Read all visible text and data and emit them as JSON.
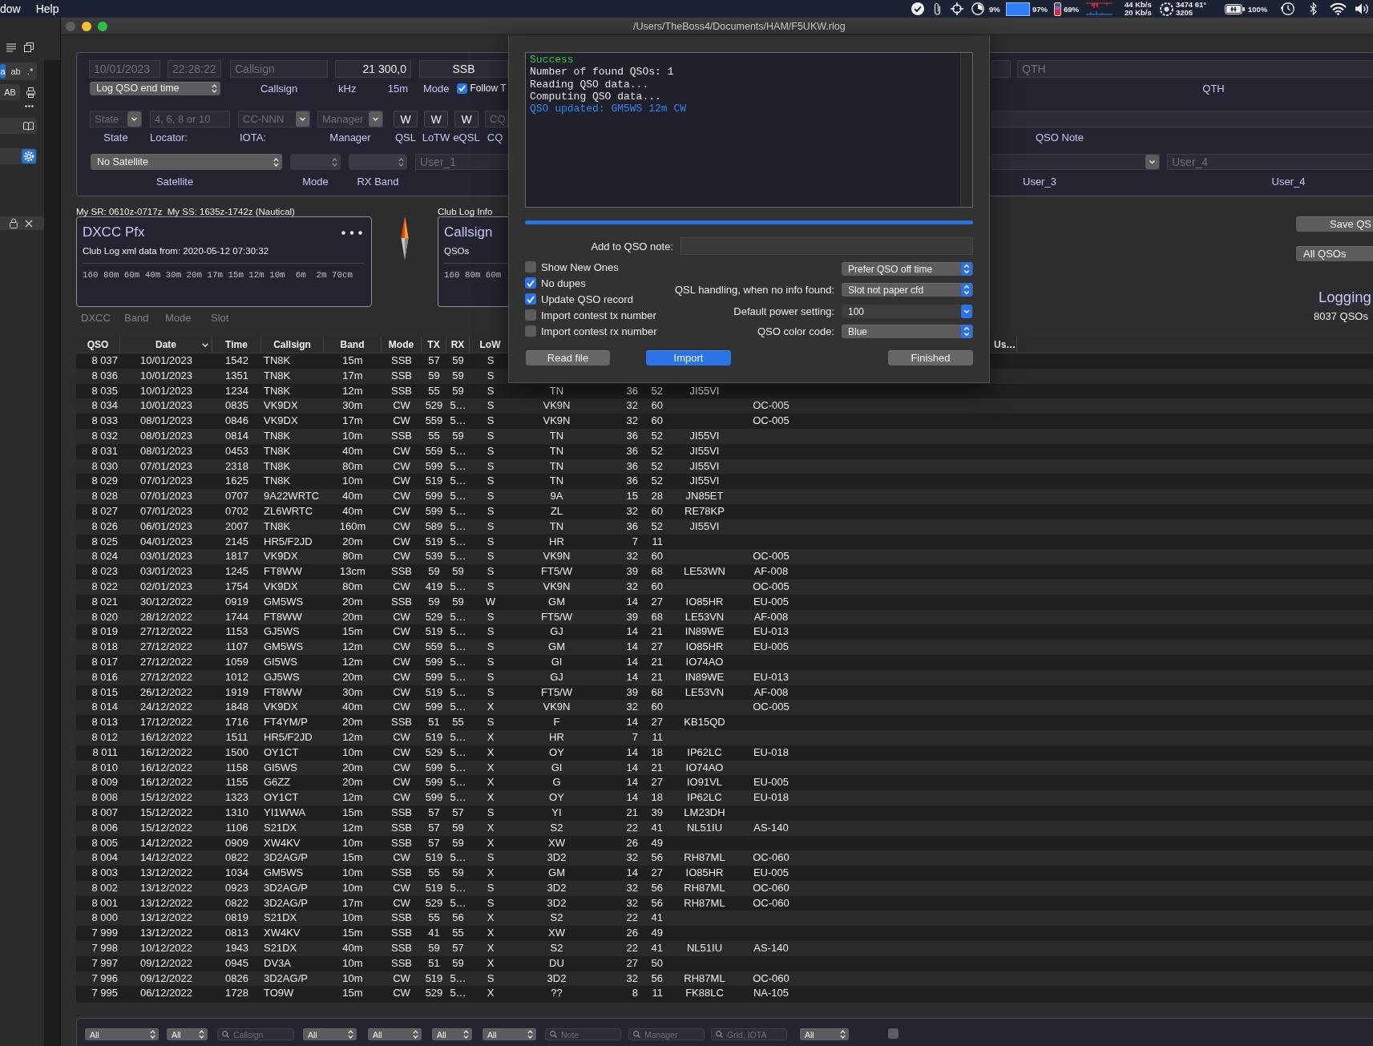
{
  "menu_bar": {
    "menus": [
      "dow",
      "Help"
    ],
    "status_texts": [
      "9%",
      "97%",
      "69%",
      "44 Kb/s",
      "20 Kb/s",
      "3474 61°",
      "3205",
      "100%"
    ]
  },
  "side_panel": {
    "tools": [
      {
        "kind": "lines",
        "selected": false
      },
      {
        "kind": "windows",
        "selected": false
      },
      {
        "kind": "glyph",
        "text": "a",
        "selected": true
      },
      {
        "kind": "glyph",
        "text": "ab",
        "selected": false
      },
      {
        "kind": "glyph",
        "text": ".*",
        "selected": false
      },
      {
        "kind": "glyph",
        "text": "AB",
        "selected": false
      },
      {
        "kind": "printer",
        "selected": false
      },
      {
        "kind": "dots",
        "selected": false
      },
      {
        "kind": "book",
        "selected": false
      },
      {
        "kind": "gear",
        "selected": true
      },
      {
        "kind": "lock",
        "selected": false
      },
      {
        "kind": "close",
        "selected": false
      }
    ]
  },
  "window": {
    "title": "/Users/TheBoss4/Documents/HAM/F5UKW.rlog"
  },
  "entry_form": {
    "date_field": {
      "placeholder": "10/01/2023"
    },
    "time_field": {
      "placeholder": "22:28:22"
    },
    "callsign_field": {
      "placeholder": "Callsign"
    },
    "frequency_field": {
      "value": "21 300,0"
    },
    "mode_field": {
      "value": "SSB"
    },
    "time_option_popup": "Log QSO end time",
    "callsign_label": "Callsign",
    "frequency_unit": "kHz",
    "band": "15m",
    "mode_label": "Mode",
    "follow_checkbox": {
      "label": "Follow T",
      "checked": true
    },
    "qth_field": {
      "placeholder": "QTH"
    },
    "qth_label": "QTH",
    "state_popup": {
      "placeholder": "State"
    },
    "state_label": "State",
    "locator_field": {
      "placeholder": "4, 6, 8 or 10"
    },
    "locator_label": "Locator:",
    "iota_combo": {
      "placeholder": "CC-NNN"
    },
    "iota_label": "IOTA:",
    "manager_combo": {
      "placeholder": "Manager"
    },
    "manager_label": "Manager",
    "qsl_buttons": [
      {
        "text": "W",
        "label": "QSL"
      },
      {
        "text": "W",
        "label": "LoTW"
      },
      {
        "text": "W",
        "label": "eQSL"
      }
    ],
    "cq_field": {
      "placeholder": "CQ"
    },
    "cq_label": "CQ",
    "qso_note_label": "QSO Note",
    "satellite_popup": "No Satellite",
    "satellite_label": "Satellite",
    "sat_mode_label": "Mode",
    "rx_band_label": "RX Band",
    "user_1_field": {
      "placeholder": "User_1"
    },
    "user_3_label": "User_3",
    "user_4_field": {
      "placeholder": "User_4"
    },
    "user_4_label": "User_4"
  },
  "info": {
    "sun_times": "My SR: 0610z-0717z  My SS: 1635z-1742z (Nautical)",
    "dxcc_panel": {
      "title": "DXCC Pfx",
      "source": "Club Log xml data from: 2020-05-12 07:30:32",
      "bands": "160 80m 60m 40m 30m 20m 17m 15m 12m 10m  6m  2m 70cm"
    },
    "view_tabs": [
      "DXCC",
      "Band",
      "Mode",
      "Slot"
    ],
    "club_log_label": "Club Log Info",
    "club_log_panel": {
      "title": "Callsign",
      "subtitle": "QSOs",
      "bands": "160 80m 60m"
    }
  },
  "side_actions": {
    "save_button": "Save QS",
    "qso_filter": "All QSOs",
    "title": "Logging",
    "qso_count": "8037 QSOs"
  },
  "table": {
    "columns": [
      {
        "label": "QSO",
        "sorted": false
      },
      {
        "label": "Date",
        "sorted": true
      },
      {
        "label": "Time",
        "sorted": false
      },
      {
        "label": "Callsign",
        "sorted": false
      },
      {
        "label": "Band",
        "sorted": false
      },
      {
        "label": "Mode",
        "sorted": false
      },
      {
        "label": "TX",
        "sorted": false
      },
      {
        "label": "RX",
        "sorted": false
      },
      {
        "label": "LoW",
        "sorted": false
      },
      {
        "label": "Us…",
        "sorted": false
      }
    ],
    "rows": [
      {
        "qso": "8 037",
        "date": "10/01/2023",
        "time": "1542",
        "callsign": "TN8K",
        "band": "15m",
        "mode": "SSB",
        "tx": "57",
        "rx": "59",
        "low": "S"
      },
      {
        "qso": "8 036",
        "date": "10/01/2023",
        "time": "1351",
        "callsign": "TN8K",
        "band": "17m",
        "mode": "SSB",
        "tx": "59",
        "rx": "59",
        "low": "S"
      },
      {
        "qso": "8 035",
        "date": "10/01/2023",
        "time": "1234",
        "callsign": "TN8K",
        "band": "12m",
        "mode": "SSB",
        "tx": "55",
        "rx": "59",
        "low": "S",
        "column_10": "TN",
        "column_11": "36",
        "column_12": "52",
        "column_13": "JI55VI"
      },
      {
        "qso": "8 034",
        "date": "10/01/2023",
        "time": "0835",
        "callsign": "VK9DX",
        "band": "30m",
        "mode": "CW",
        "tx": "529",
        "rx": "5…",
        "low": "S",
        "column_10": "VK9N",
        "column_11": "32",
        "column_12": "60",
        "column_14": "OC-005"
      },
      {
        "qso": "8 033",
        "date": "08/01/2023",
        "time": "0846",
        "callsign": "VK9DX",
        "band": "17m",
        "mode": "CW",
        "tx": "559",
        "rx": "5…",
        "low": "S",
        "column_10": "VK9N",
        "column_11": "32",
        "column_12": "60",
        "column_14": "OC-005"
      },
      {
        "qso": "8 032",
        "date": "08/01/2023",
        "time": "0814",
        "callsign": "TN8K",
        "band": "10m",
        "mode": "SSB",
        "tx": "55",
        "rx": "59",
        "low": "S",
        "column_10": "TN",
        "column_11": "36",
        "column_12": "52",
        "column_13": "JI55VI"
      },
      {
        "qso": "8 031",
        "date": "08/01/2023",
        "time": "0453",
        "callsign": "TN8K",
        "band": "40m",
        "mode": "CW",
        "tx": "559",
        "rx": "5…",
        "low": "S",
        "column_10": "TN",
        "column_11": "36",
        "column_12": "52",
        "column_13": "JI55VI"
      },
      {
        "qso": "8 030",
        "date": "07/01/2023",
        "time": "2318",
        "callsign": "TN8K",
        "band": "80m",
        "mode": "CW",
        "tx": "599",
        "rx": "5…",
        "low": "S",
        "column_10": "TN",
        "column_11": "36",
        "column_12": "52",
        "column_13": "JI55VI"
      },
      {
        "qso": "8 029",
        "date": "07/01/2023",
        "time": "1625",
        "callsign": "TN8K",
        "band": "10m",
        "mode": "CW",
        "tx": "519",
        "rx": "5…",
        "low": "S",
        "column_10": "TN",
        "column_11": "36",
        "column_12": "52",
        "column_13": "JI55VI"
      },
      {
        "qso": "8 028",
        "date": "07/01/2023",
        "time": "0707",
        "callsign": "9A22WRTC",
        "band": "40m",
        "mode": "CW",
        "tx": "599",
        "rx": "5…",
        "low": "S",
        "column_10": "9A",
        "column_11": "15",
        "column_12": "28",
        "column_13": "JN85ET"
      },
      {
        "qso": "8 027",
        "date": "07/01/2023",
        "time": "0702",
        "callsign": "ZL6WRTC",
        "band": "40m",
        "mode": "CW",
        "tx": "599",
        "rx": "5…",
        "low": "S",
        "column_10": "ZL",
        "column_11": "32",
        "column_12": "60",
        "column_13": "RE78KP"
      },
      {
        "qso": "8 026",
        "date": "06/01/2023",
        "time": "2007",
        "callsign": "TN8K",
        "band": "160m",
        "mode": "CW",
        "tx": "589",
        "rx": "5…",
        "low": "S",
        "column_10": "TN",
        "column_11": "36",
        "column_12": "52",
        "column_13": "JI55VI"
      },
      {
        "qso": "8 025",
        "date": "04/01/2023",
        "time": "2145",
        "callsign": "HR5/F2JD",
        "band": "20m",
        "mode": "CW",
        "tx": "519",
        "rx": "5…",
        "low": "S",
        "column_10": "HR",
        "column_11": "7",
        "column_12": "11"
      },
      {
        "qso": "8 024",
        "date": "03/01/2023",
        "time": "1817",
        "callsign": "VK9DX",
        "band": "80m",
        "mode": "CW",
        "tx": "539",
        "rx": "5…",
        "low": "S",
        "column_10": "VK9N",
        "column_11": "32",
        "column_12": "60",
        "column_14": "OC-005"
      },
      {
        "qso": "8 023",
        "date": "03/01/2023",
        "time": "1245",
        "callsign": "FT8WW",
        "band": "13cm",
        "mode": "SSB",
        "tx": "59",
        "rx": "59",
        "low": "S",
        "column_10": "FT5/W",
        "column_11": "39",
        "column_12": "68",
        "column_13": "LE53WN",
        "column_14": "AF-008"
      },
      {
        "qso": "8 022",
        "date": "02/01/2023",
        "time": "1754",
        "callsign": "VK9DX",
        "band": "80m",
        "mode": "CW",
        "tx": "419",
        "rx": "5…",
        "low": "S",
        "column_10": "VK9N",
        "column_11": "32",
        "column_12": "60",
        "column_14": "OC-005"
      },
      {
        "qso": "8 021",
        "date": "30/12/2022",
        "time": "0919",
        "callsign": "GM5WS",
        "band": "20m",
        "mode": "SSB",
        "tx": "59",
        "rx": "59",
        "low": "W",
        "column_10": "GM",
        "column_11": "14",
        "column_12": "27",
        "column_13": "IO85HR",
        "column_14": "EU-005"
      },
      {
        "qso": "8 020",
        "date": "28/12/2022",
        "time": "1744",
        "callsign": "FT8WW",
        "band": "20m",
        "mode": "CW",
        "tx": "529",
        "rx": "5…",
        "low": "S",
        "column_10": "FT5/W",
        "column_11": "39",
        "column_12": "68",
        "column_13": "LE53VN",
        "column_14": "AF-008"
      },
      {
        "qso": "8 019",
        "date": "27/12/2022",
        "time": "1153",
        "callsign": "GJ5WS",
        "band": "15m",
        "mode": "CW",
        "tx": "519",
        "rx": "5…",
        "low": "S",
        "column_10": "GJ",
        "column_11": "14",
        "column_12": "21",
        "column_13": "IN89WE",
        "column_14": "EU-013"
      },
      {
        "qso": "8 018",
        "date": "27/12/2022",
        "time": "1107",
        "callsign": "GM5WS",
        "band": "12m",
        "mode": "CW",
        "tx": "559",
        "rx": "5…",
        "low": "S",
        "column_10": "GM",
        "column_11": "14",
        "column_12": "27",
        "column_13": "IO85HR",
        "column_14": "EU-005"
      },
      {
        "qso": "8 017",
        "date": "27/12/2022",
        "time": "1059",
        "callsign": "GI5WS",
        "band": "12m",
        "mode": "CW",
        "tx": "599",
        "rx": "5…",
        "low": "S",
        "column_10": "GI",
        "column_11": "14",
        "column_12": "21",
        "column_13": "IO74AO"
      },
      {
        "qso": "8 016",
        "date": "27/12/2022",
        "time": "1012",
        "callsign": "GJ5WS",
        "band": "20m",
        "mode": "CW",
        "tx": "599",
        "rx": "5…",
        "low": "S",
        "column_10": "GJ",
        "column_11": "14",
        "column_12": "21",
        "column_13": "IN89WE",
        "column_14": "EU-013"
      },
      {
        "qso": "8 015",
        "date": "26/12/2022",
        "time": "1919",
        "callsign": "FT8WW",
        "band": "30m",
        "mode": "CW",
        "tx": "519",
        "rx": "5…",
        "low": "S",
        "column_10": "FT5/W",
        "column_11": "39",
        "column_12": "68",
        "column_13": "LE53VN",
        "column_14": "AF-008"
      },
      {
        "qso": "8 014",
        "date": "24/12/2022",
        "time": "1848",
        "callsign": "VK9DX",
        "band": "40m",
        "mode": "CW",
        "tx": "599",
        "rx": "5…",
        "low": "X",
        "column_10": "VK9N",
        "column_11": "32",
        "column_12": "60",
        "column_14": "OC-005"
      },
      {
        "qso": "8 013",
        "date": "17/12/2022",
        "time": "1716",
        "callsign": "FT4YM/P",
        "band": "20m",
        "mode": "SSB",
        "tx": "51",
        "rx": "55",
        "low": "S",
        "column_10": "F",
        "column_11": "14",
        "column_12": "27",
        "column_13": "KB15QD"
      },
      {
        "qso": "8 012",
        "date": "16/12/2022",
        "time": "1511",
        "callsign": "HR5/F2JD",
        "band": "12m",
        "mode": "CW",
        "tx": "519",
        "rx": "5…",
        "low": "X",
        "column_10": "HR",
        "column_11": "7",
        "column_12": "11"
      },
      {
        "qso": "8 011",
        "date": "16/12/2022",
        "time": "1500",
        "callsign": "OY1CT",
        "band": "10m",
        "mode": "CW",
        "tx": "529",
        "rx": "5…",
        "low": "X",
        "column_10": "OY",
        "column_11": "14",
        "column_12": "18",
        "column_13": "IP62LC",
        "column_14": "EU-018"
      },
      {
        "qso": "8 010",
        "date": "16/12/2022",
        "time": "1158",
        "callsign": "GI5WS",
        "band": "20m",
        "mode": "CW",
        "tx": "599",
        "rx": "5…",
        "low": "X",
        "column_10": "GI",
        "column_11": "14",
        "column_12": "21",
        "column_13": "IO74AO"
      },
      {
        "qso": "8 009",
        "date": "16/12/2022",
        "time": "1155",
        "callsign": "G6ZZ",
        "band": "20m",
        "mode": "CW",
        "tx": "599",
        "rx": "5…",
        "low": "X",
        "column_10": "G",
        "column_11": "14",
        "column_12": "27",
        "column_13": "IO91VL",
        "column_14": "EU-005"
      },
      {
        "qso": "8 008",
        "date": "15/12/2022",
        "time": "1323",
        "callsign": "OY1CT",
        "band": "12m",
        "mode": "CW",
        "tx": "599",
        "rx": "5…",
        "low": "X",
        "column_10": "OY",
        "column_11": "14",
        "column_12": "18",
        "column_13": "IP62LC",
        "column_14": "EU-018"
      },
      {
        "qso": "8 007",
        "date": "15/12/2022",
        "time": "1310",
        "callsign": "YI1WWA",
        "band": "15m",
        "mode": "SSB",
        "tx": "57",
        "rx": "57",
        "low": "S",
        "column_10": "YI",
        "column_11": "21",
        "column_12": "39",
        "column_13": "LM23DH"
      },
      {
        "qso": "8 006",
        "date": "15/12/2022",
        "time": "1106",
        "callsign": "S21DX",
        "band": "12m",
        "mode": "SSB",
        "tx": "57",
        "rx": "59",
        "low": "X",
        "column_10": "S2",
        "column_11": "22",
        "column_12": "41",
        "column_13": "NL51IU",
        "column_14": "AS-140"
      },
      {
        "qso": "8 005",
        "date": "14/12/2022",
        "time": "0909",
        "callsign": "XW4KV",
        "band": "10m",
        "mode": "SSB",
        "tx": "57",
        "rx": "59",
        "low": "X",
        "column_10": "XW",
        "column_11": "26",
        "column_12": "49"
      },
      {
        "qso": "8 004",
        "date": "14/12/2022",
        "time": "0822",
        "callsign": "3D2AG/P",
        "band": "15m",
        "mode": "CW",
        "tx": "519",
        "rx": "5…",
        "low": "S",
        "column_10": "3D2",
        "column_11": "32",
        "column_12": "56",
        "column_13": "RH87ML",
        "column_14": "OC-060"
      },
      {
        "qso": "8 003",
        "date": "13/12/2022",
        "time": "1034",
        "callsign": "GM5WS",
        "band": "10m",
        "mode": "SSB",
        "tx": "55",
        "rx": "59",
        "low": "X",
        "column_10": "GM",
        "column_11": "14",
        "column_12": "27",
        "column_13": "IO85HR",
        "column_14": "EU-005"
      },
      {
        "qso": "8 002",
        "date": "13/12/2022",
        "time": "0923",
        "callsign": "3D2AG/P",
        "band": "10m",
        "mode": "CW",
        "tx": "519",
        "rx": "5…",
        "low": "S",
        "column_10": "3D2",
        "column_11": "32",
        "column_12": "56",
        "column_13": "RH87ML",
        "column_14": "OC-060"
      },
      {
        "qso": "8 001",
        "date": "13/12/2022",
        "time": "0822",
        "callsign": "3D2AG/P",
        "band": "17m",
        "mode": "CW",
        "tx": "529",
        "rx": "5…",
        "low": "S",
        "column_10": "3D2",
        "column_11": "32",
        "column_12": "56",
        "column_13": "RH87ML",
        "column_14": "OC-060"
      },
      {
        "qso": "8 000",
        "date": "13/12/2022",
        "time": "0819",
        "callsign": "S21DX",
        "band": "10m",
        "mode": "SSB",
        "tx": "55",
        "rx": "56",
        "low": "X",
        "column_10": "S2",
        "column_11": "22",
        "column_12": "41"
      },
      {
        "qso": "7 999",
        "date": "13/12/2022",
        "time": "0813",
        "callsign": "XW4KV",
        "band": "15m",
        "mode": "SSB",
        "tx": "41",
        "rx": "55",
        "low": "X",
        "column_10": "XW",
        "column_11": "26",
        "column_12": "49"
      },
      {
        "qso": "7 998",
        "date": "10/12/2022",
        "time": "1943",
        "callsign": "S21DX",
        "band": "40m",
        "mode": "SSB",
        "tx": "59",
        "rx": "57",
        "low": "X",
        "column_10": "S2",
        "column_11": "22",
        "column_12": "41",
        "column_13": "NL51IU",
        "column_14": "AS-140"
      },
      {
        "qso": "7 997",
        "date": "09/12/2022",
        "time": "0945",
        "callsign": "DV3A",
        "band": "10m",
        "mode": "SSB",
        "tx": "51",
        "rx": "59",
        "low": "X",
        "column_10": "DU",
        "column_11": "27",
        "column_12": "50"
      },
      {
        "qso": "7 996",
        "date": "09/12/2022",
        "time": "0826",
        "callsign": "3D2AG/P",
        "band": "10m",
        "mode": "CW",
        "tx": "519",
        "rx": "5…",
        "low": "S",
        "column_10": "3D2",
        "column_11": "32",
        "column_12": "56",
        "column_13": "RH87ML",
        "column_14": "OC-060"
      },
      {
        "qso": "7 995",
        "date": "06/12/2022",
        "time": "1728",
        "callsign": "TO9W",
        "band": "15m",
        "mode": "CW",
        "tx": "529",
        "rx": "5…",
        "low": "X",
        "column_10": "??",
        "column_11": "8",
        "column_12": "11",
        "column_13": "FK88LC",
        "column_14": "NA-105"
      }
    ]
  },
  "filter_bar": {
    "items": [
      {
        "kind": "popup",
        "value": "All"
      },
      {
        "kind": "popup",
        "value": "All"
      },
      {
        "kind": "search",
        "placeholder": "Callsign"
      },
      {
        "kind": "popup",
        "value": "All"
      },
      {
        "kind": "popup",
        "value": "All"
      },
      {
        "kind": "popup",
        "value": "All"
      },
      {
        "kind": "popup",
        "value": "All"
      },
      {
        "kind": "search",
        "placeholder": "Note"
      },
      {
        "kind": "search",
        "placeholder": "Manager"
      },
      {
        "kind": "search",
        "placeholder": "Grid, IOTA"
      },
      {
        "kind": "popup",
        "value": "All"
      },
      {
        "kind": "checkbox",
        "checked": false
      }
    ]
  },
  "import_dialog": {
    "log": [
      {
        "kind": "success",
        "text": "Success"
      },
      {
        "kind": "info",
        "text": "Number of found QSOs: 1"
      },
      {
        "kind": "info",
        "text": "Reading QSO data..."
      },
      {
        "kind": "info",
        "text": "Computing QSO data..."
      },
      {
        "kind": "update",
        "text": "QSO updated: GM5WS 12m CW"
      }
    ],
    "progress": {
      "level": 1
    },
    "note_label": "Add to QSO note:",
    "options": [
      {
        "label": "Show New Ones",
        "checked": false
      },
      {
        "label": "No dupes",
        "checked": true
      },
      {
        "label": "Update QSO record",
        "checked": true
      },
      {
        "label": "Import contest tx number",
        "checked": false
      },
      {
        "label": "Import contest rx number",
        "checked": false
      }
    ],
    "settings": [
      {
        "kind": "popup",
        "value": "Prefer QSO off time"
      },
      {
        "kind": "popup",
        "label": "QSL handling, when no info found:",
        "value": "Slot not paper cfd"
      },
      {
        "kind": "combo",
        "label": "Default power setting:",
        "value": "100"
      },
      {
        "kind": "popup",
        "label": "QSO color code:",
        "value": "Blue"
      }
    ],
    "buttons": [
      {
        "text": "Read file",
        "default": false
      },
      {
        "text": "Import",
        "default": true
      },
      {
        "text": "Finished",
        "default": false
      }
    ]
  }
}
